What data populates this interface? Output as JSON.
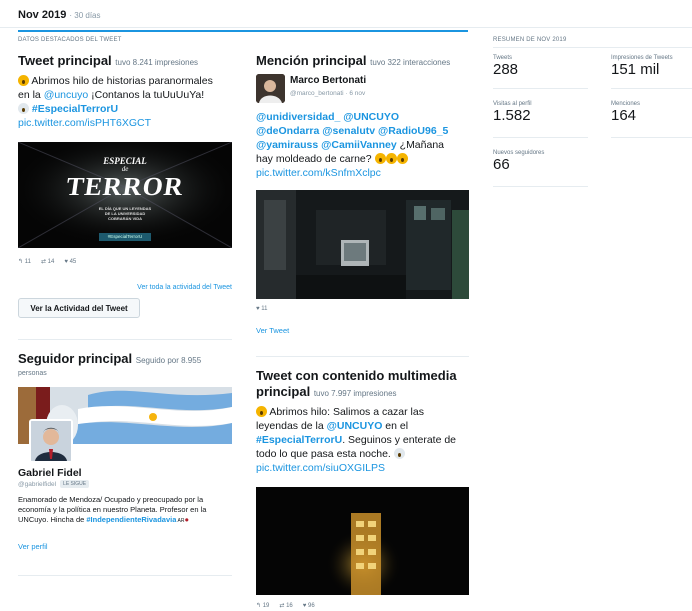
{
  "header": {
    "title": "Nov 2019",
    "subtitle": "· 30 días"
  },
  "highlights": {
    "section_label": "DATOS DESTACADOS DEL TWEET",
    "top_tweet": {
      "title": "Tweet principal",
      "meta": "tuvo 8.241 impresiones",
      "line1": "Abrimos hilo de historias paranormales",
      "line2a": "en la ",
      "mention": "@uncuyo",
      "line2b": " ¡Contanos la tuUuUuYa!",
      "hashtag": "#EspecialTerrorU",
      "url": "pic.twitter.com/isPHT6XGCT",
      "image": {
        "line1": "ESPECIAL",
        "line2": "de",
        "line3": "TERROR",
        "sub1": "EL DÍA QUE UN LEYENDAS",
        "sub2": "DE LA UNIVERSIDAD",
        "sub3": "COBRARÁN VIDA",
        "tag": "#EspecialTerrorU"
      },
      "replies": "11",
      "retweets": "14",
      "likes": "45",
      "activity_link": "Ver toda la actividad del Tweet",
      "activity_button": "Ver la Actividad del Tweet"
    },
    "top_mention": {
      "title": "Mención principal",
      "meta": "tuvo 322 interacciones",
      "name": "Marco Bertonati",
      "handle": "@marco_bertonati · 6 nov",
      "l1a": "@unidiversidad_",
      "l1b": "@UNCUYO",
      "l2a": "@deOndarra",
      "l2b": "@senalutv",
      "l2c": "@RadioU96_5",
      "l3a": "@yamirauss",
      "l3b": "@CamiiVanney",
      "l3c": " ¿Mañana",
      "l4": "hay moldeado de carne?",
      "url": "pic.twitter.com/kSnfmXclpc",
      "likes": "11",
      "view_link": "Ver Tweet"
    },
    "top_follower": {
      "title": "Seguidor principal",
      "meta1": "Seguido por 8.955",
      "meta2": "personas",
      "name": "Gabriel Fidel",
      "handle": "@gabrielfidel",
      "badge": "LE SIGUE",
      "bio1": "Enamorado de Mendoza/ Ocupado y preocupado por la",
      "bio2": "economía y la política en nuestro Planeta. Profesor en la",
      "bio3a": "UNCuyo. Hincha de ",
      "bio3b": "#IndependienteRivadavia",
      "bio3c": " AR",
      "profile_link": "Ver perfil"
    },
    "top_media": {
      "title1": "Tweet con contenido multimedia",
      "title2": "principal",
      "meta": "tuvo 7.997 impresiones",
      "l1": "Abrimos hilo: Salimos a cazar las",
      "l2a": "leyendas de la ",
      "l2b": "@UNCUYO",
      "l2c": " en el",
      "l3a": "#EspecialTerrorU",
      "l3b": ". Seguinos y enterate de",
      "l4": "todo lo que pasa esta noche.",
      "url": "pic.twitter.com/siuOXGILPS",
      "replies": "19",
      "retweets": "16",
      "likes": "96"
    }
  },
  "summary": {
    "section_label": "RESUMEN DE NOV 2019",
    "tweets_label": "Tweets",
    "tweets_value": "288",
    "impressions_label": "Impresiones de Tweets",
    "impressions_value": "151 mil",
    "visits_label": "Visitas al perfil",
    "visits_value": "1.582",
    "mentions_label": "Menciones",
    "mentions_value": "164",
    "followers_label": "Nuevos seguidores",
    "followers_value": "66"
  },
  "colors": {
    "accent": "#1b95e0",
    "text": "#14171a",
    "muted": "#657786"
  }
}
